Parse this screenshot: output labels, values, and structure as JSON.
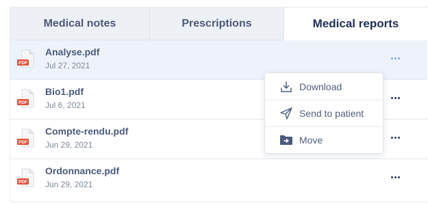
{
  "tabs": [
    {
      "label": "Medical notes",
      "active": false
    },
    {
      "label": "Prescriptions",
      "active": false
    },
    {
      "label": "Medical reports",
      "active": true
    }
  ],
  "file_badge": "PDF",
  "files": [
    {
      "name": "Analyse.pdf",
      "date": "Jul 27, 2021",
      "selected": true
    },
    {
      "name": "Bio1.pdf",
      "date": "Jul 6, 2021",
      "selected": false
    },
    {
      "name": "Compte-rendu.pdf",
      "date": "Jun 29, 2021",
      "selected": false
    },
    {
      "name": "Ordonnance.pdf",
      "date": "Jun 29, 2021",
      "selected": false
    }
  ],
  "context_menu": {
    "items": [
      {
        "label": "Download",
        "icon": "download-icon"
      },
      {
        "label": "Send to patient",
        "icon": "send-icon"
      },
      {
        "label": "Move",
        "icon": "folder-move-icon"
      }
    ]
  },
  "colors": {
    "accent": "#7fa8e6",
    "pdf_badge": "#e0523d",
    "selected_row": "#eef3fb",
    "text_primary": "#4b5a7d"
  }
}
